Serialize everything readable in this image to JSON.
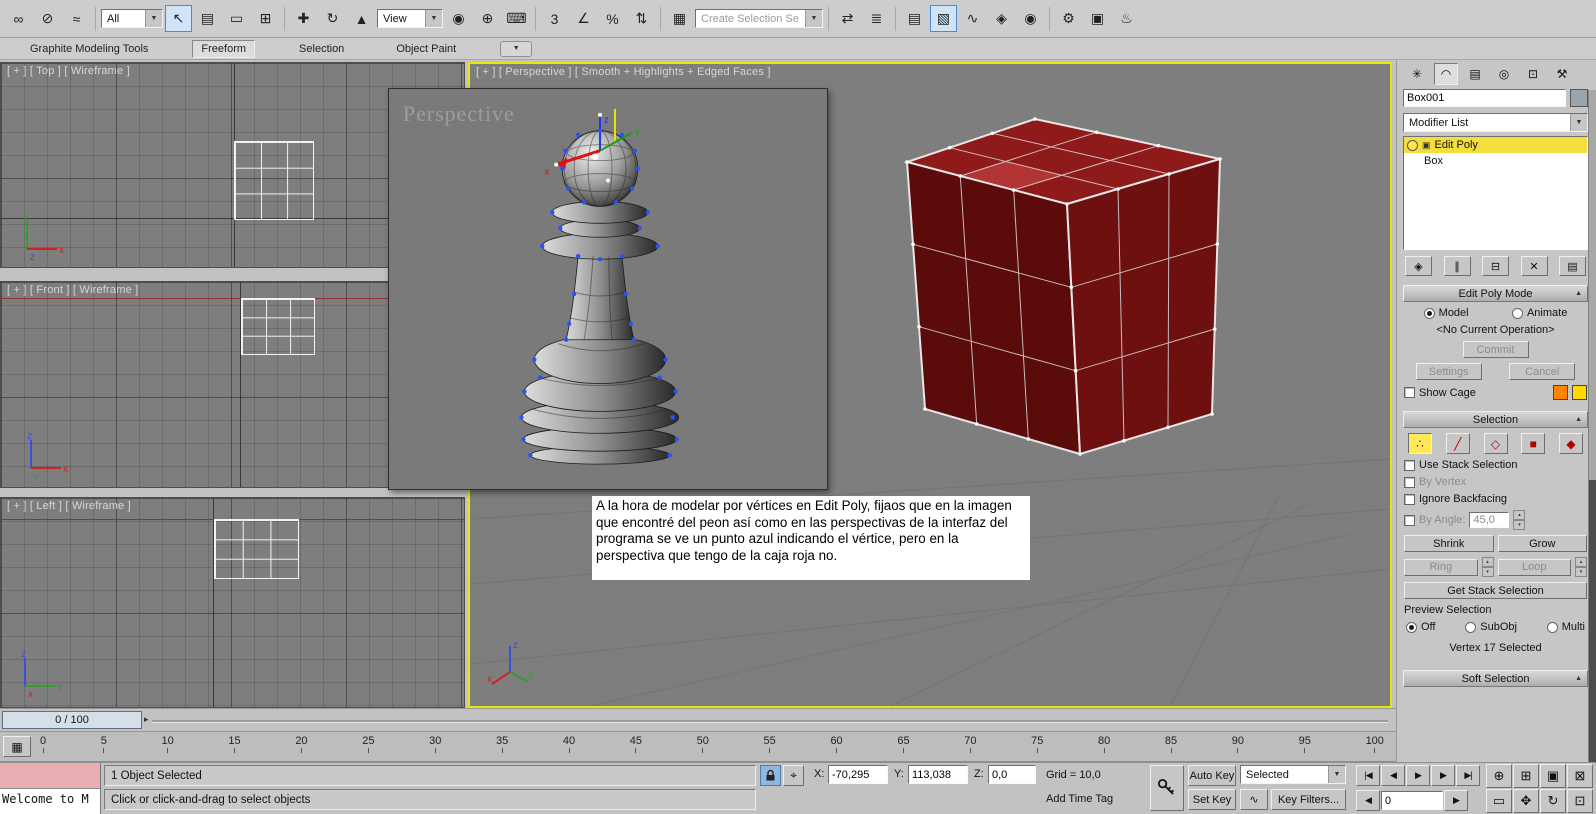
{
  "app": {
    "accent_yellow": "#e8e412",
    "viewport_gray": "#7e7e7e"
  },
  "icons": {
    "chevron_down": "▼",
    "spin_up": "▴",
    "spin_down": "▾",
    "rollout_collapse": "▲",
    "slider_arrow": "▸",
    "absolute_mode": "⌖",
    "trackbar_tool": "▦"
  },
  "toolbar": {
    "items": [
      {
        "name": "select-and-link",
        "glyph": "∞"
      },
      {
        "name": "unlink-selection",
        "glyph": "⊘"
      },
      {
        "name": "bind-to-space-warp",
        "glyph": "≈"
      },
      {
        "name": "selection-filter",
        "label": "All"
      },
      {
        "name": "select-object",
        "glyph": "↖"
      },
      {
        "name": "select-by-name",
        "glyph": "▤"
      },
      {
        "name": "rectangular-selection-region",
        "glyph": "▭"
      },
      {
        "name": "window-crossing",
        "glyph": "⊞"
      },
      {
        "name": "select-and-move",
        "glyph": "✚"
      },
      {
        "name": "select-and-rotate",
        "glyph": "↻"
      },
      {
        "name": "select-and-scale",
        "glyph": "▲"
      },
      {
        "name": "reference-coordinate-system",
        "label": "View"
      },
      {
        "name": "use-pivot-point-center",
        "glyph": "◉"
      },
      {
        "name": "select-and-manipulate",
        "glyph": "⊕"
      },
      {
        "name": "keyboard-shortcut-override",
        "glyph": "⌨"
      },
      {
        "name": "snaps-toggle",
        "glyph": "3"
      },
      {
        "name": "angle-snap",
        "glyph": "∠"
      },
      {
        "name": "percent-snap",
        "glyph": "%"
      },
      {
        "name": "spinner-snap",
        "glyph": "⇅"
      },
      {
        "name": "edit-named-selection-sets",
        "glyph": "▦"
      },
      {
        "name": "named-selection-set",
        "label": "Create Selection Se"
      },
      {
        "name": "mirror",
        "glyph": "⇄"
      },
      {
        "name": "align",
        "glyph": "≣"
      },
      {
        "name": "layer-manager",
        "glyph": "▤"
      },
      {
        "name": "graphite-ribbon-toggle",
        "glyph": "▧"
      },
      {
        "name": "curve-editor",
        "glyph": "∿"
      },
      {
        "name": "schematic-view",
        "glyph": "◈"
      },
      {
        "name": "material-editor",
        "glyph": "◉"
      },
      {
        "name": "render-setup",
        "glyph": "⚙"
      },
      {
        "name": "rendered-frame-window",
        "glyph": "▣"
      },
      {
        "name": "render-production",
        "glyph": "♨"
      }
    ]
  },
  "ribbon": {
    "tabs": [
      "Graphite Modeling Tools",
      "Freeform",
      "Selection",
      "Object Paint"
    ]
  },
  "viewports": {
    "top_label": "[ + ] [ Top ] [ Wireframe ]",
    "front_label": "[ + ] [ Front ] [ Wireframe ]",
    "left_label": "[ + ] [ Left ] [ Wireframe ]",
    "persp_label": "[ + ] [ Perspective ] [ Smooth + Highlights + Edged Faces ]",
    "inset_watermark": "Perspective",
    "annotation": "A la hora de modelar por vértices en Edit Poly, fijaos que en la imagen que encontré del peon así como en las perspectivas de la interfaz del programa se ve un punto azul indicando el vértice, pero en la perspectiva que tengo de la caja roja no.",
    "box_colors": {
      "top": "#8e1a1a",
      "left": "#5c0b0b",
      "right": "#6e1010",
      "edges": "#e6e6e6"
    }
  },
  "command_panel": {
    "tab_glyphs": [
      "✳",
      "◠",
      "▤",
      "◎",
      "⊡",
      "⚒"
    ],
    "object_name": "Box001",
    "modifier_list": "Modifier List",
    "stack": {
      "modifier": "Edit Poly",
      "base": "Box"
    },
    "stack_tools": [
      "◈",
      "∥",
      "⊟",
      "✕",
      "▤"
    ],
    "edit_poly_mode": {
      "title": "Edit Poly Mode",
      "model": "Model",
      "animate": "Animate",
      "operation": "<No Current Operation>",
      "commit": "Commit",
      "settings": "Settings",
      "cancel": "Cancel",
      "show_cage": "Show Cage",
      "cage_color_1": "#ff8400",
      "cage_color_2": "#ffd900"
    },
    "selection": {
      "title": "Selection",
      "sel_icons": [
        "∴",
        "╱",
        "◇",
        "■",
        "◆"
      ],
      "use_stack": "Use Stack Selection",
      "by_vertex": "By Vertex",
      "ignore_backfacing": "Ignore Backfacing",
      "by_angle": "By Angle:",
      "by_angle_value": "45,0",
      "shrink": "Shrink",
      "grow": "Grow",
      "ring": "Ring",
      "loop": "Loop",
      "get_stack": "Get Stack Selection",
      "preview": "Preview Selection",
      "off": "Off",
      "subobj": "SubObj",
      "multi": "Multi",
      "status": "Vertex 17 Selected"
    },
    "soft_selection_title": "Soft Selection"
  },
  "timeline": {
    "handle": "0 / 100"
  },
  "trackbar": {
    "ticks": [
      "0",
      "5",
      "10",
      "15",
      "20",
      "25",
      "30",
      "35",
      "40",
      "45",
      "50",
      "55",
      "60",
      "65",
      "70",
      "75",
      "80",
      "85",
      "90",
      "95",
      "100"
    ]
  },
  "statusbar": {
    "listener_text": "Welcome to M",
    "status": "1 Object Selected",
    "prompt": "Click or click-and-drag to select objects",
    "x_label": "X:",
    "x_value": "-70,295",
    "y_label": "Y:",
    "y_value": "113,038",
    "z_label": "Z:",
    "z_value": "0,0",
    "grid": "Grid = 10,0",
    "time_tag": "Add Time Tag",
    "auto_key": "Auto Key",
    "set_key": "Set Key",
    "selected": "Selected",
    "key_filters": "Key Filters...",
    "tangent_glyph": "∿",
    "frame": "0",
    "playback": [
      "|◀",
      "◀",
      "▶",
      "▶",
      "▶|"
    ],
    "nav": [
      "⊕",
      "⊞",
      "▣",
      "⊠",
      "▭",
      "✥",
      "↻",
      "⊡"
    ]
  }
}
